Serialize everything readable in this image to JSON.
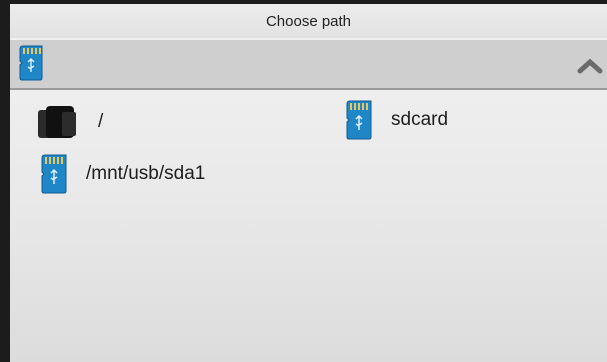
{
  "dialog": {
    "title": "Choose path"
  },
  "path_bar": {
    "current_icon": "sdcard-icon",
    "collapse_icon": "chevron-up-icon"
  },
  "entries": [
    {
      "label": "/",
      "icon": "device-icon"
    },
    {
      "label": "sdcard",
      "icon": "sdcard-icon"
    },
    {
      "label": "/mnt/usb/sda1",
      "icon": "sdcard-icon"
    }
  ],
  "colors": {
    "sd_card_blue": "#1f86c8",
    "sd_card_contacts": "#e8c75a",
    "background": "#ececec",
    "path_bar": "#cfcfcf"
  }
}
